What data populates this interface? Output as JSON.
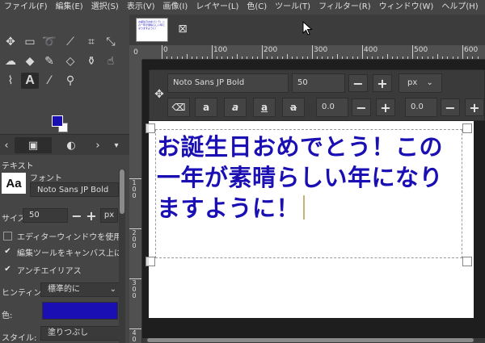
{
  "menu": [
    "ファイル(F)",
    "編集(E)",
    "選択(S)",
    "表示(V)",
    "画像(I)",
    "レイヤー(L)",
    "色(C)",
    "ツール(T)",
    "フィルター(R)",
    "ウィンドウ(W)",
    "ヘルプ(H)"
  ],
  "colors": {
    "foreground": "#1a0fb3",
    "background": "#ffffff",
    "text": "#1a0fb3"
  },
  "tool_options": {
    "title": "テキスト",
    "font_preview": "Aa",
    "font_label": "フォント",
    "font_name": "Noto Sans JP Bold",
    "size_label": "サイズ:",
    "size_value": "50",
    "size_unit": "px",
    "use_editor": "エディターウィンドウを使用",
    "on_canvas": "編集ツールをキャンバス上に表",
    "antialias": "アンチエイリアス",
    "hinting_label": "ヒンティング:",
    "hinting_value": "標準的に",
    "color_label": "色:",
    "style_label": "スタイル:",
    "style_value": "塗りつぶし"
  },
  "ruler": {
    "top": [
      "0",
      "100",
      "200",
      "300",
      "400",
      "500",
      "600"
    ],
    "left": [
      [
        "1",
        "0",
        "0"
      ],
      [
        "2",
        "0",
        "0"
      ],
      [
        "3",
        "0",
        "0"
      ],
      [
        "4",
        "0",
        "0"
      ]
    ],
    "origin": "0"
  },
  "text_toolbar": {
    "font": "Noto Sans JP Bold",
    "size": "50",
    "unit": "px",
    "baseline": "0.0",
    "kerning": "0.0",
    "style_buttons": [
      "a",
      "a",
      "a",
      "a"
    ]
  },
  "canvas_text": "お誕生日おめでとう！この一年が素晴らしい年になりますように！",
  "thumbnail_text": "お誕生日おめでとう！この一年が素晴らしい年になりますように！"
}
